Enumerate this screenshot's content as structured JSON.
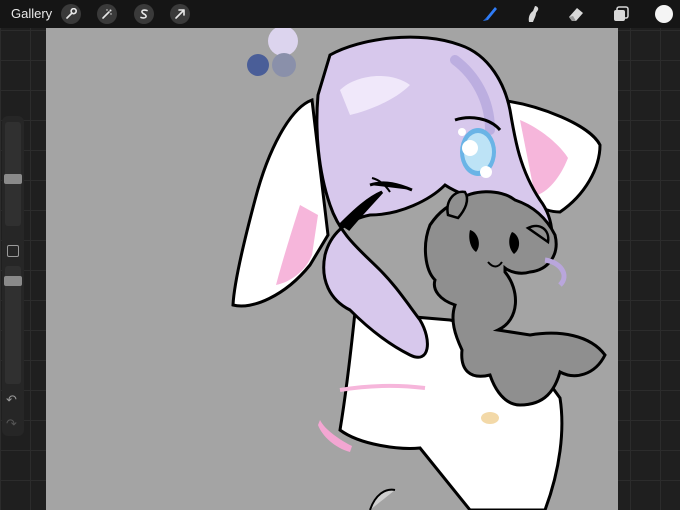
{
  "topbar": {
    "gallery_label": "Gallery",
    "left_tools": [
      "wrench-icon",
      "magic-wand-icon",
      "selection-icon",
      "transform-arrow-icon"
    ],
    "right_tools": [
      "brush-icon",
      "smudge-icon",
      "eraser-icon",
      "layers-icon"
    ],
    "active_tool": "brush-icon",
    "current_color": "#f4f4f4",
    "active_tool_color": "#2f7cf6"
  },
  "sidebar": {
    "brush_size_level": 0.55,
    "opacity_level": 0.95,
    "icons": [
      "modify-button-icon",
      "undo-icon",
      "redo-icon"
    ]
  },
  "canvas": {
    "background": "#a4a4a4",
    "palette_swatches": [
      "#dcd4ee",
      "#4a5e98",
      "#8a90aa"
    ]
  }
}
